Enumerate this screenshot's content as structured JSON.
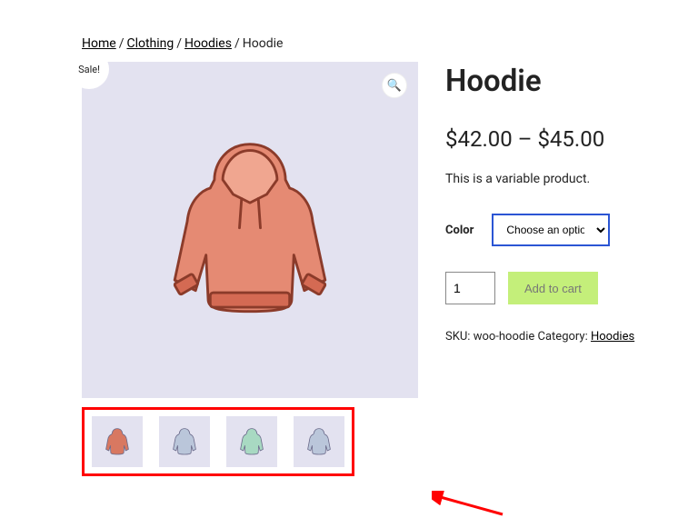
{
  "breadcrumb": {
    "home": "Home",
    "clothing": "Clothing",
    "hoodies": "Hoodies",
    "current": "Hoodie"
  },
  "sale_label": "Sale!",
  "zoom_icon": "🔍",
  "product": {
    "title": "Hoodie",
    "price_low": "$42.00",
    "price_sep": "–",
    "price_high": "$45.00",
    "description": "This is a variable product.",
    "attribute_label": "Color",
    "attribute_placeholder": "Choose an option",
    "quantity": "1",
    "add_to_cart": "Add to cart",
    "sku_label": "SKU:",
    "sku_value": "woo-hoodie",
    "category_label": "Category:",
    "category_value": "Hoodies"
  },
  "thumbs": {
    "colors": [
      "#d87861",
      "#bac6da",
      "#a8d9c2",
      "#bac6da"
    ],
    "names": [
      "thumb-red",
      "thumb-blue",
      "thumb-green",
      "thumb-blue-logo"
    ]
  }
}
